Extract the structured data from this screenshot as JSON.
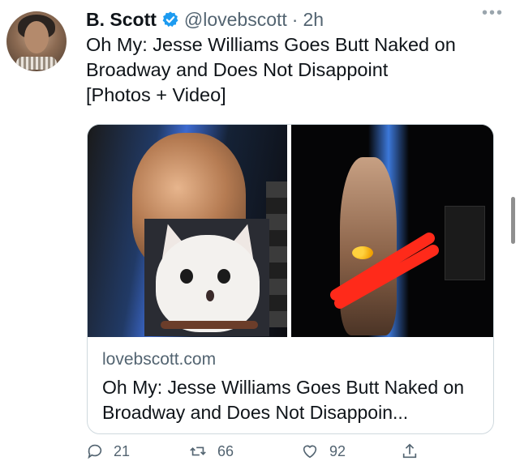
{
  "tweet": {
    "display_name": "B. Scott",
    "handle": "@lovebscott",
    "separator": "·",
    "time": "2h",
    "verified": true,
    "more_icon": "more-horizontal-icon",
    "text": "Oh My: Jesse Williams Goes Butt Naked on\nBroadway and Does Not Disappoint\n[Photos + Video]"
  },
  "card": {
    "domain": "lovebscott.com",
    "title": "Oh My: Jesse Williams Goes Butt Naked on Broadway and Does Not Disappoin..."
  },
  "actions": {
    "reply_count": "21",
    "retweet_count": "66",
    "like_count": "92",
    "share_icon": "share-icon"
  },
  "colors": {
    "verified_blue": "#1d9bf0",
    "muted_text": "#536471",
    "scribble_red": "#ff2a1a"
  }
}
